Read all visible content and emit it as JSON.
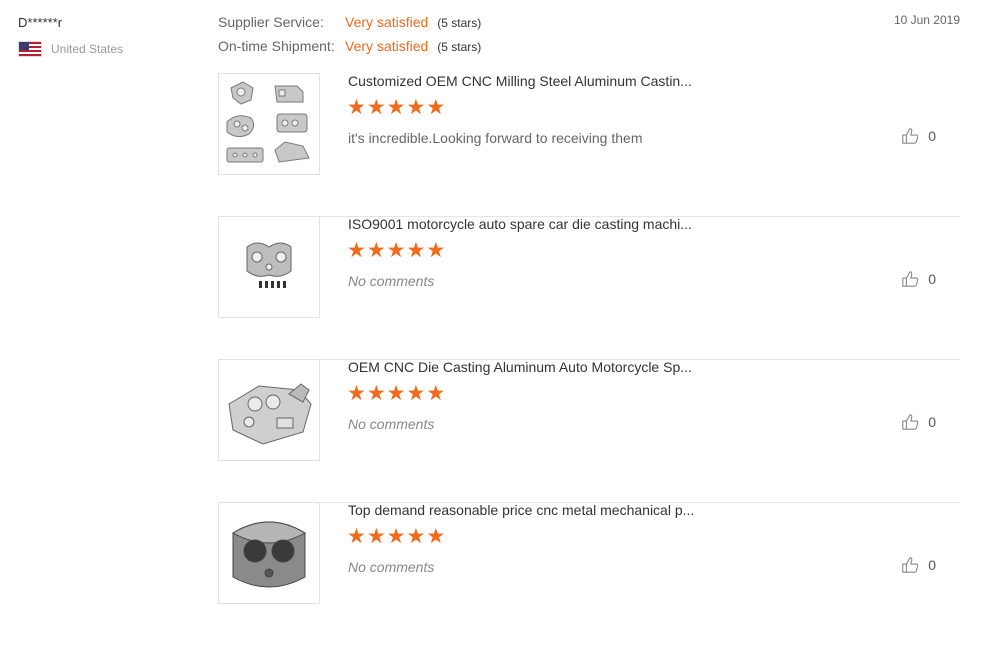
{
  "buyer": {
    "name": "D******r",
    "country": "United States"
  },
  "ratings": [
    {
      "label": "Supplier Service:",
      "value": "Very satisfied",
      "stars": "(5 stars)"
    },
    {
      "label": "On-time Shipment:",
      "value": "Very satisfied",
      "stars": "(5 stars)"
    }
  ],
  "date": "10 Jun 2019",
  "reviews": [
    {
      "title": "Customized OEM CNC Milling Steel Aluminum Castin...",
      "rating": 5,
      "comment": "it's incredible.Looking forward to receiving them",
      "likes": "0",
      "image_icon": "cast-parts-collage"
    },
    {
      "title": "ISO9001 motorcycle auto spare car die casting machi...",
      "rating": 5,
      "comment": "No comments",
      "likes": "0",
      "image_icon": "die-cast-housing-with-screws"
    },
    {
      "title": "OEM CNC Die Casting Aluminum Auto Motorcycle Sp...",
      "rating": 5,
      "comment": "No comments",
      "likes": "0",
      "image_icon": "aluminum-engine-block"
    },
    {
      "title": "Top demand reasonable price cnc metal mechanical p...",
      "rating": 5,
      "comment": "No comments",
      "likes": "0",
      "image_icon": "machined-metal-part"
    }
  ],
  "colors": {
    "accent": "#f26a1b",
    "divider": "#e5e5e5"
  }
}
